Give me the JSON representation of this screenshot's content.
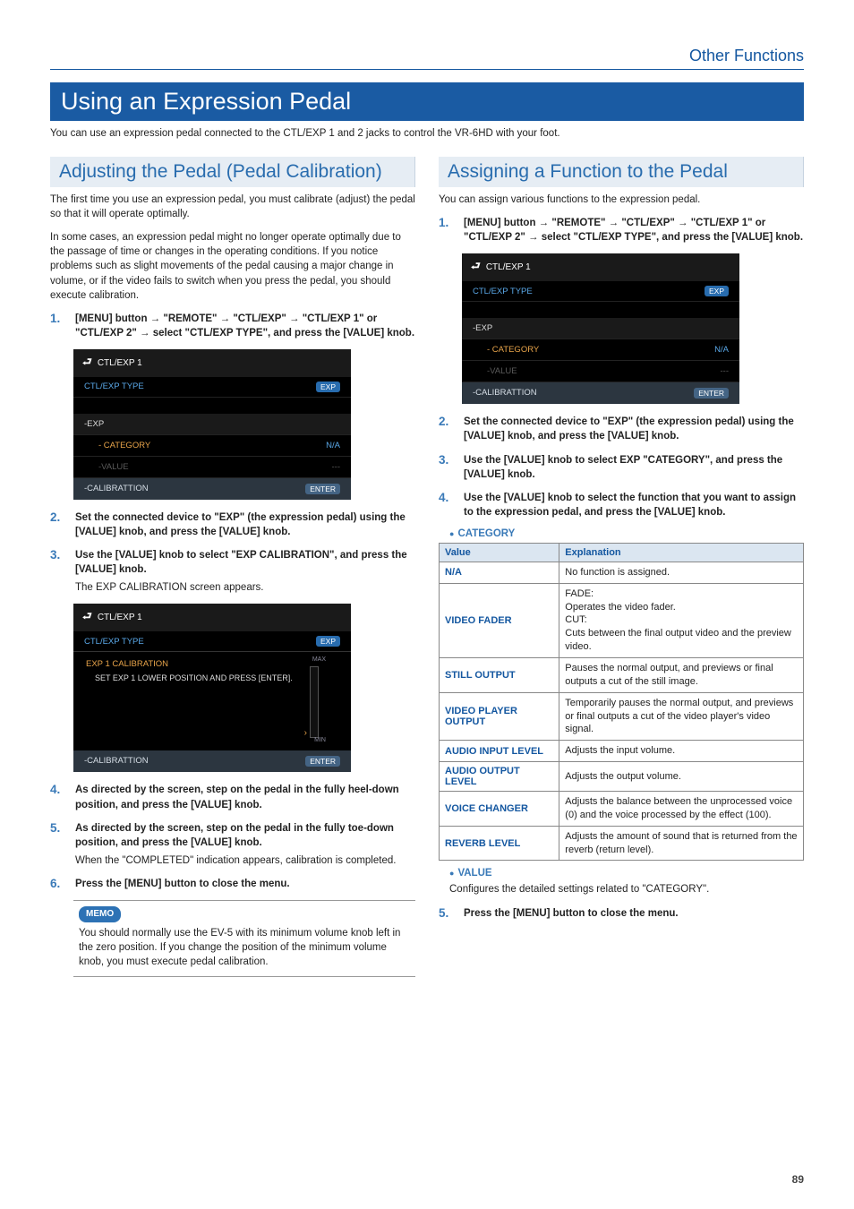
{
  "header": {
    "label": "Other Functions"
  },
  "title": "Using an Expression Pedal",
  "intro": "You can use an expression pedal connected to the CTL/EXP 1 and 2 jacks to control the VR-6HD with your foot.",
  "page_number": "89",
  "left": {
    "subtitle": "Adjusting the Pedal (Pedal Calibration)",
    "p1": "The first time you use an expression pedal, you must calibrate (adjust) the pedal so that it will operate optimally.",
    "p2": "In some cases, an expression pedal might no longer operate optimally due to the passage of time or changes in the operating conditions. If you notice problems such as slight movements of the pedal causing a major change in volume, or if the video fails to switch when you press the pedal, you should execute calibration.",
    "step1": "[MENU] button → \"REMOTE\" → \"CTL/EXP\" → \"CTL/EXP 1\" or \"CTL/EXP 2\" → select \"CTL/EXP TYPE\", and press the [VALUE] knob.",
    "screenshot1": {
      "header": "CTL/EXP 1",
      "row1_label": "CTL/EXP TYPE",
      "row1_value": "EXP",
      "group": "-EXP",
      "sub_label": "- CATEGORY",
      "sub_value": "N/A",
      "gray_label": "-VALUE",
      "gray_value": "---",
      "calib_label": "-CALIBRATTION",
      "calib_value": "ENTER"
    },
    "step2": "Set the connected device to \"EXP\" (the expression pedal) using the [VALUE] knob, and press the [VALUE] knob.",
    "step3": "Use the [VALUE] knob to select \"EXP CALIBRATION\", and press the [VALUE] knob.",
    "step3_sub": "The EXP CALIBRATION screen appears.",
    "screenshot2": {
      "header": "CTL/EXP 1",
      "row1_label": "CTL/EXP TYPE",
      "row1_value": "EXP",
      "line1": "EXP 1 CALIBRATION",
      "line2": "SET EXP 1 LOWER POSITION AND PRESS [ENTER].",
      "max": "MAX",
      "min": "MIN",
      "calib_label": "-CALIBRATTION",
      "calib_value": "ENTER"
    },
    "step4": "As directed by the screen, step on the pedal in the fully heel-down position, and press the [VALUE] knob.",
    "step5": "As directed by the screen, step on the pedal in the fully toe-down position, and press the [VALUE] knob.",
    "step5_sub": "When the \"COMPLETED\" indication appears, calibration is completed.",
    "step6": "Press the [MENU] button to close the menu.",
    "memo_tag": "MEMO",
    "memo_body": "You should normally use the EV-5 with its minimum volume knob left in the zero position. If you change the position of the minimum volume knob, you must execute pedal calibration."
  },
  "right": {
    "subtitle": "Assigning a Function to the Pedal",
    "p1": "You can assign various functions to the expression pedal.",
    "step1": "[MENU] button → \"REMOTE\" → \"CTL/EXP\" → \"CTL/EXP 1\" or \"CTL/EXP 2\" → select \"CTL/EXP TYPE\", and press the [VALUE] knob.",
    "screenshot1": {
      "header": "CTL/EXP 1",
      "row1_label": "CTL/EXP TYPE",
      "row1_value": "EXP",
      "group": "-EXP",
      "sub_label": "- CATEGORY",
      "sub_value": "N/A",
      "gray_label": "-VALUE",
      "gray_value": "---",
      "calib_label": "-CALIBRATTION",
      "calib_value": "ENTER"
    },
    "step2": "Set the connected device to \"EXP\" (the expression pedal) using the [VALUE] knob, and press the [VALUE] knob.",
    "step3": "Use the [VALUE] knob to select EXP \"CATEGORY\", and press the [VALUE] knob.",
    "step4": "Use the [VALUE] knob to select the function that you want to assign to the expression pedal, and press the [VALUE] knob.",
    "catLabel": "CATEGORY",
    "table": {
      "h1": "Value",
      "h2": "Explanation",
      "rows": [
        {
          "k": "N/A",
          "v": "No function is assigned."
        },
        {
          "k": "VIDEO FADER",
          "v": "FADE:\nOperates the video fader.\nCUT:\nCuts between the final output video and the preview video."
        },
        {
          "k": "STILL OUTPUT",
          "v": "Pauses the normal output, and previews or final outputs a cut of the still image."
        },
        {
          "k": "VIDEO PLAYER OUTPUT",
          "v": "Temporarily pauses the normal output, and previews or final outputs a cut of the video player's video signal."
        },
        {
          "k": "AUDIO INPUT LEVEL",
          "v": "Adjusts the input volume."
        },
        {
          "k": "AUDIO OUTPUT LEVEL",
          "v": "Adjusts the output volume."
        },
        {
          "k": "VOICE CHANGER",
          "v": "Adjusts the balance between the unprocessed voice (0) and the voice processed by the effect (100)."
        },
        {
          "k": "REVERB LEVEL",
          "v": "Adjusts the amount of sound that is returned from the reverb (return level)."
        }
      ]
    },
    "valueLabel": "VALUE",
    "valueText": "Configures the detailed settings related to \"CATEGORY\".",
    "step5": "Press the [MENU] button to close the menu."
  }
}
